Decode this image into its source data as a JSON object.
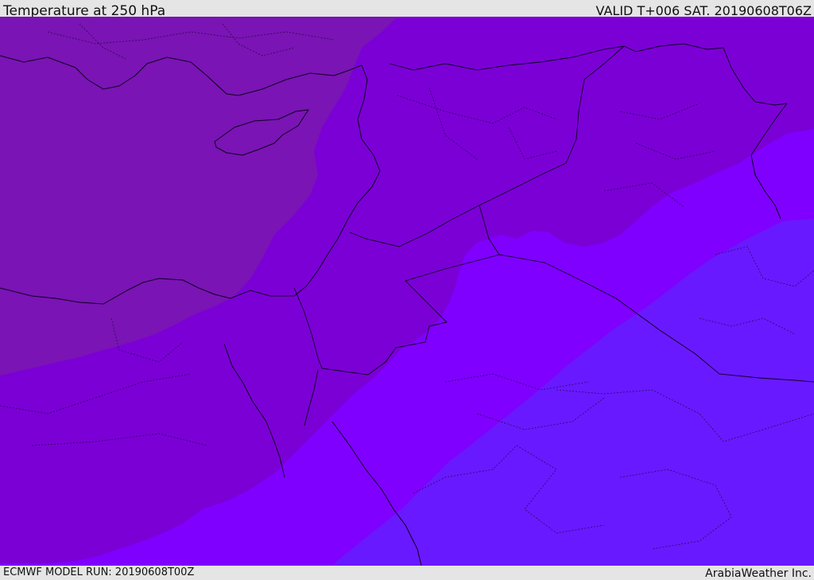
{
  "header": {
    "title": "Temperature at 250 hPa",
    "valid": "VALID T+006 SAT. 20190608T06Z"
  },
  "footer": {
    "model_run": "ECMWF MODEL RUN: 20190608T00Z",
    "credit": "ArabiaWeather Inc."
  },
  "bands": {
    "band_1": "#7a14b4",
    "band_2": "#7b00d6",
    "band_3": "#7f00ff",
    "band_4": "#6919ff"
  },
  "colors": {
    "coastline": "#0d0020",
    "borders": "#0d0020"
  }
}
